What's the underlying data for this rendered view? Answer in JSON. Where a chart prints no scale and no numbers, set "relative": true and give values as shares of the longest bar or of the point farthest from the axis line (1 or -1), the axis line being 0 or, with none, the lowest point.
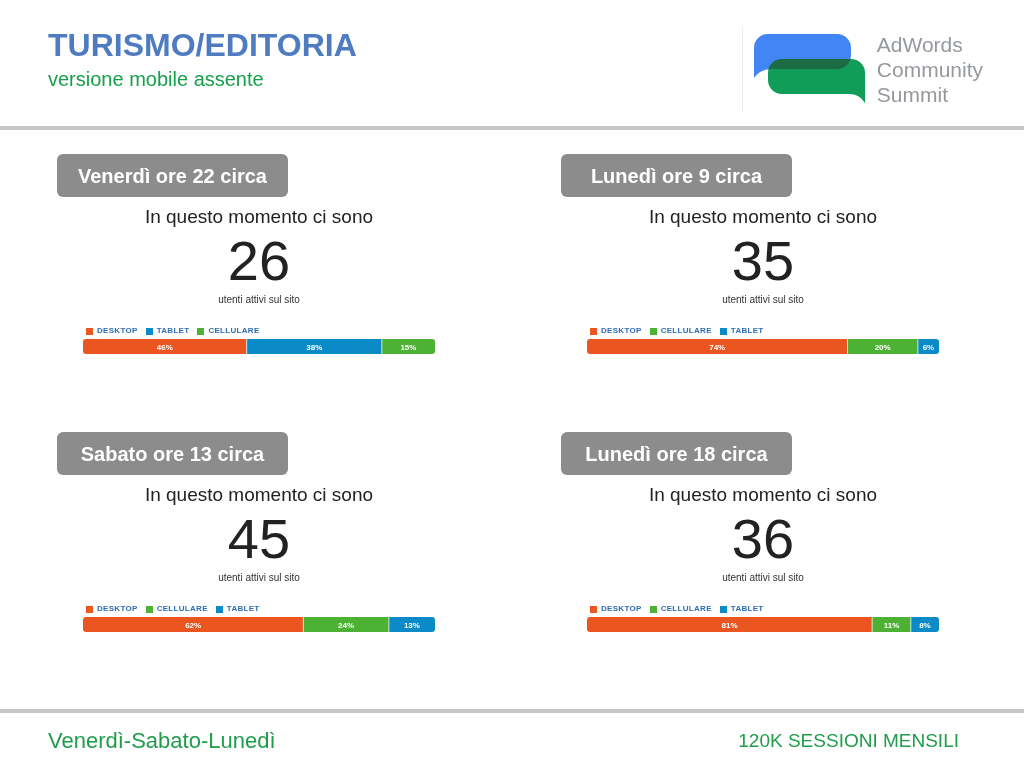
{
  "header": {
    "title": "TURISMO/EDITORIA",
    "subtitle": "versione mobile assente",
    "logo": {
      "lines": [
        "AdWords",
        "Community",
        "Summit"
      ]
    }
  },
  "panels": [
    {
      "label": "Venerdì ore 22 circa",
      "intro": "In questo momento ci sono",
      "count": "26",
      "caption": "utenti attivi sul sito",
      "chart_data": {
        "type": "bar",
        "orientation": "horizontal",
        "stacked": true,
        "relative": true,
        "legend": "top",
        "categories": [
          null
        ],
        "series": [
          {
            "name": "DESKTOP",
            "color": "#ea5520",
            "values": [
              0.465
            ]
          },
          {
            "name": "TABLET",
            "color": "#0b8ac8",
            "values": [
              0.384
            ]
          },
          {
            "name": "CELLULARE",
            "color": "#4db234",
            "values": [
              0.151
            ]
          }
        ],
        "value_labels": [
          "46%",
          "38%",
          "15%"
        ]
      }
    },
    {
      "label": "Lunedì ore 9 circa",
      "intro": "In questo momento ci sono",
      "count": "35",
      "caption": "utenti attivi sul sito",
      "chart_data": {
        "type": "bar",
        "orientation": "horizontal",
        "stacked": true,
        "relative": true,
        "legend": "top",
        "categories": [
          null
        ],
        "series": [
          {
            "name": "DESKTOP",
            "color": "#ea5520",
            "values": [
              0.74
            ]
          },
          {
            "name": "CELLULARE",
            "color": "#4db234",
            "values": [
              0.2
            ]
          },
          {
            "name": "TABLET",
            "color": "#0b8ac8",
            "values": [
              0.06
            ]
          }
        ],
        "value_labels": [
          "74%",
          "20%",
          "6%"
        ]
      }
    },
    {
      "label": "Sabato ore 13 circa",
      "intro": "In questo momento ci sono",
      "count": "45",
      "caption": "utenti attivi sul sito",
      "chart_data": {
        "type": "bar",
        "orientation": "horizontal",
        "stacked": true,
        "relative": true,
        "legend": "top",
        "categories": [
          null
        ],
        "series": [
          {
            "name": "DESKTOP",
            "color": "#ea5520",
            "values": [
              0.626
            ]
          },
          {
            "name": "CELLULARE",
            "color": "#4db234",
            "values": [
              0.243
            ]
          },
          {
            "name": "TABLET",
            "color": "#0b8ac8",
            "values": [
              0.131
            ]
          }
        ],
        "value_labels": [
          "62%",
          "24%",
          "13%"
        ]
      }
    },
    {
      "label": "Lunedì ore 18 circa",
      "intro": "In questo momento ci sono",
      "count": "36",
      "caption": "utenti attivi sul sito",
      "chart_data": {
        "type": "bar",
        "orientation": "horizontal",
        "stacked": true,
        "relative": true,
        "legend": "top",
        "categories": [
          null
        ],
        "series": [
          {
            "name": "DESKTOP",
            "color": "#ea5520",
            "values": [
              0.81
            ]
          },
          {
            "name": "CELLULARE",
            "color": "#4db234",
            "values": [
              0.11
            ]
          },
          {
            "name": "TABLET",
            "color": "#0b8ac8",
            "values": [
              0.08
            ]
          }
        ],
        "value_labels": [
          "81%",
          "11%",
          "8%"
        ]
      }
    }
  ],
  "footer": {
    "left": "Venerdì-Sabato-Lunedì",
    "right": "120K SESSIONI MENSILI"
  }
}
